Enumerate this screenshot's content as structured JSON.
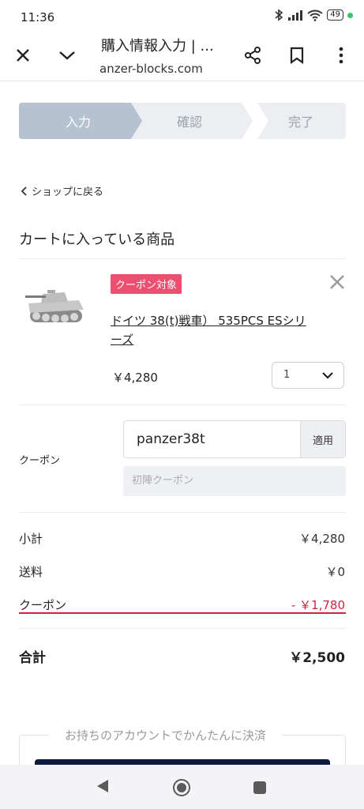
{
  "status_bar": {
    "time": "11:36",
    "battery": "49"
  },
  "browser": {
    "title": "購入情報入力 | ...",
    "url": "anzer-blocks.com"
  },
  "steps": [
    {
      "label": "入力",
      "active": true
    },
    {
      "label": "確認",
      "active": false
    },
    {
      "label": "完了",
      "active": false
    }
  ],
  "back_link": "ショップに戻る",
  "cart_title": "カートに入っている商品",
  "product": {
    "badge": "クーポン対象",
    "name": "ドイツ 38(t)戦車） 535PCS ESシリーズ",
    "price": "￥4,280",
    "quantity": "1"
  },
  "coupon": {
    "label": "クーポン",
    "input_value": "panzer38t",
    "apply_label": "適用",
    "chip": "初陣クーポン"
  },
  "summary": {
    "subtotal_label": "小計",
    "subtotal_value": "￥4,280",
    "shipping_label": "送料",
    "shipping_value": "￥0",
    "coupon_label": "クーポン",
    "coupon_value": "- ￥1,780",
    "total_label": "合計",
    "total_value": "￥2,500"
  },
  "account_caption": "お持ちのアカウントでかんたんに決済",
  "colors": {
    "accent_red": "#d0233f",
    "badge_pink": "#ec4f6f",
    "step_active": "#b6c2d0",
    "step_inactive": "#eceef2",
    "pay_button": "#101a3f"
  }
}
